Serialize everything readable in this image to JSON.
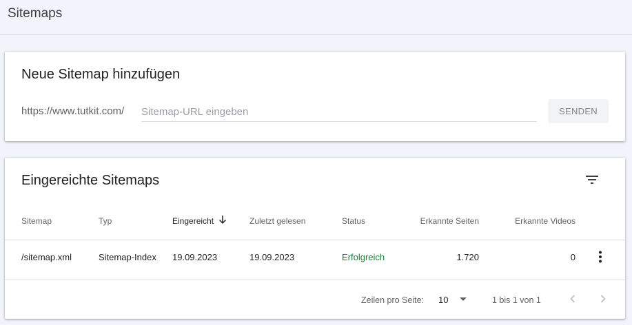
{
  "page": {
    "title": "Sitemaps"
  },
  "add_card": {
    "title": "Neue Sitemap hinzufügen",
    "prefix": "https://www.tutkit.com/",
    "input_value": "",
    "input_placeholder": "Sitemap-URL eingeben",
    "send_label": "SENDEN"
  },
  "list_card": {
    "title": "Eingereichte Sitemaps",
    "columns": [
      "Sitemap",
      "Typ",
      "Eingereicht",
      "Zuletzt gelesen",
      "Status",
      "Erkannte Seiten",
      "Erkannte Videos"
    ],
    "rows": [
      {
        "sitemap": "/sitemap.xml",
        "type": "Sitemap-Index",
        "submitted": "19.09.2023",
        "last_read": "19.09.2023",
        "status": "Erfolgreich",
        "pages": "1.720",
        "videos": "0"
      }
    ],
    "footer": {
      "rows_per_page_label": "Zeilen pro Seite:",
      "rows_per_page": "10",
      "range": "1 bis 1 von 1"
    }
  },
  "colors": {
    "success": "#188038",
    "text": "#202124",
    "muted": "#5f6368"
  },
  "icons": [
    "filter-icon",
    "sort-down-arrow-icon",
    "more-vert-icon",
    "dropdown-arrow-icon",
    "chevron-left-icon",
    "chevron-right-icon"
  ]
}
